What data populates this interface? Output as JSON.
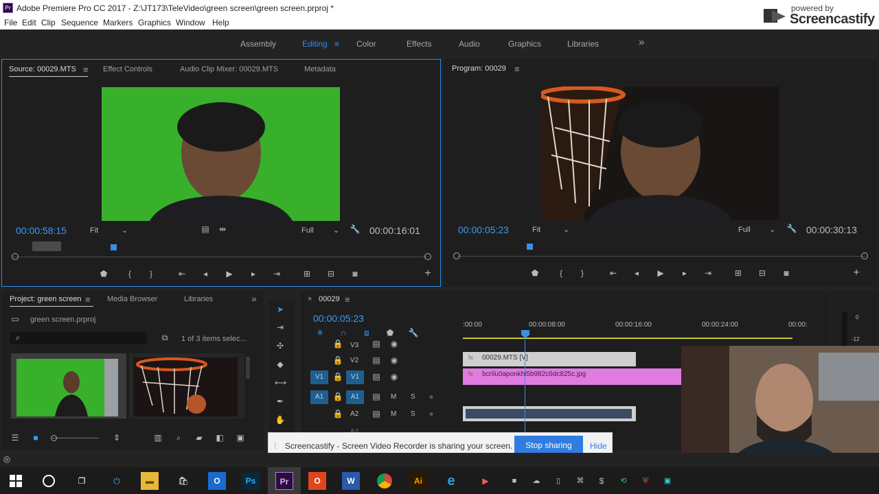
{
  "window": {
    "title": "Adobe Premiere Pro CC 2017 - Z:\\JT173\\TeleVideo\\green screen\\green screen.prproj *",
    "app_badge": "Pr"
  },
  "menu": [
    "File",
    "Edit",
    "Clip",
    "Sequence",
    "Markers",
    "Graphics",
    "Window",
    "Help"
  ],
  "watermark": {
    "line1": "powered by",
    "line2": "Screencastify"
  },
  "workspaces": [
    "Assembly",
    "Editing",
    "Color",
    "Effects",
    "Audio",
    "Graphics",
    "Libraries"
  ],
  "workspace_overflow": "»",
  "source": {
    "tabs": [
      "Source: 00029.MTS",
      "Effect Controls",
      "Audio Clip Mixer: 00029.MTS",
      "Metadata"
    ],
    "timecode": "00:00:58:15",
    "fit": "Fit",
    "quality": "Full",
    "duration": "00:00:16:01"
  },
  "program": {
    "tab": "Program: 00029",
    "timecode": "00:00:05:23",
    "fit": "Fit",
    "quality": "Full",
    "duration": "00:00:30:13"
  },
  "project": {
    "tabs": [
      "Project: green screen",
      "Media Browser",
      "Libraries"
    ],
    "file": "green screen.prproj",
    "items_count": "1 of 3 items selec..."
  },
  "timeline": {
    "sequence": "00029",
    "timecode": "00:00:05:23",
    "ruler": [
      ":00:00",
      "00:00:08:00",
      "00:00:16:00",
      "00:00:24:00",
      "00:00:"
    ],
    "tracks": [
      "V3",
      "V2",
      "V1",
      "A1",
      "A2",
      "A3"
    ],
    "source_patch": [
      "V1",
      "A1"
    ],
    "mute": "M",
    "solo": "S",
    "clips": [
      {
        "name": "00029.MTS [V]"
      },
      {
        "name": "bcrilu0aponkhi5b982c6dc825c.jpg"
      }
    ],
    "meter": [
      "0",
      "-12"
    ]
  },
  "notification": {
    "message": "Screencastify - Screen Video Recorder is sharing your screen.",
    "stop": "Stop sharing",
    "hide": "Hide"
  },
  "taskbar": [
    "Ps",
    "Pr",
    "W",
    "Ai"
  ],
  "colors": {
    "accent": "#2d8ceb",
    "green_screen": "#38b02c",
    "clip_pink": "#e07be0",
    "clip_video": "#cfcfcf"
  }
}
